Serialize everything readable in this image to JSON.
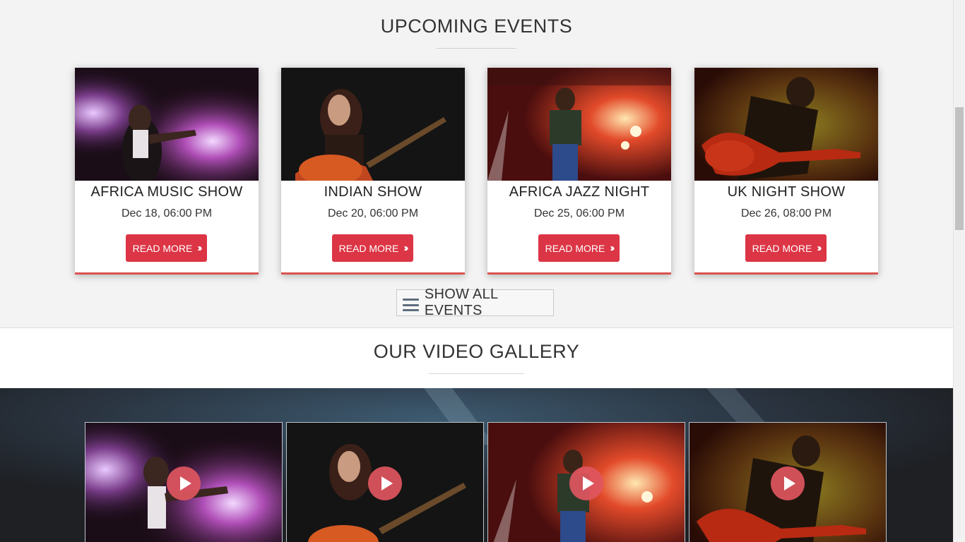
{
  "events_section": {
    "title": "UPCOMING EVENTS",
    "events": [
      {
        "name": "AFRICA MUSIC SHOW",
        "date": "Dec 18, 06:00 PM",
        "button": "READ MORE"
      },
      {
        "name": "INDIAN SHOW",
        "date": "Dec 20, 06:00 PM",
        "button": "READ MORE"
      },
      {
        "name": "AFRICA JAZZ NIGHT",
        "date": "Dec 25, 06:00 PM",
        "button": "READ MORE"
      },
      {
        "name": "UK NIGHT SHOW",
        "date": "Dec 26, 08:00 PM",
        "button": "READ MORE"
      }
    ],
    "show_all_label": "SHOW ALL EVENTS",
    "show_all_icon": "menu-icon",
    "button_icon": "double-chevron-right-icon"
  },
  "video_section": {
    "title": "OUR VIDEO GALLERY",
    "play_icon": "play-icon"
  },
  "colors": {
    "accent": "#dc3545",
    "card_border": "#d9534f",
    "play_button": "#e05660"
  }
}
